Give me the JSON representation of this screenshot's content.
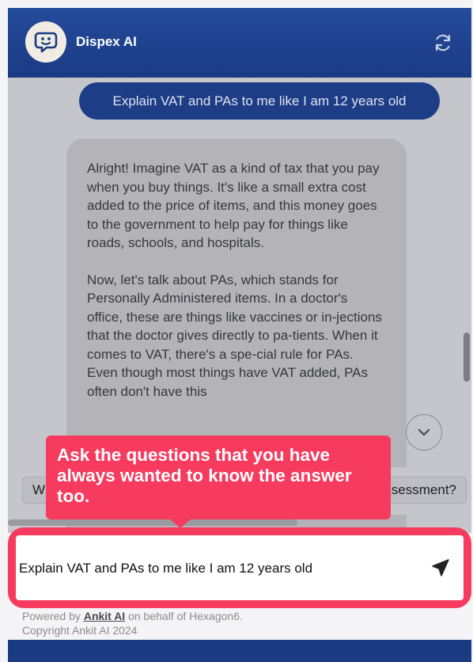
{
  "header": {
    "title": "Dispex AI",
    "avatar_icon": "chat-bubble-icon",
    "refresh_icon": "refresh-icon"
  },
  "chat": {
    "user_message": "Explain VAT and PAs to me like I am 12 years old",
    "bot_paragraph_1": "Alright! Imagine VAT as a kind of tax that you pay when you buy things. It's like a small extra cost added to the price of items, and this money goes to the government to help pay for things like roads, schools, and hospitals.",
    "bot_paragraph_2": "Now, let's talk about PAs, which stands for Personally Administered items. In a doctor's office, these are things like vaccines or in-jections that the doctor gives directly to pa-tients. When it comes to VAT, there's a spe-cial rule for PAs. Even though most things have VAT added, PAs often don't have this"
  },
  "suggestions": {
    "left_label": "W",
    "right_label": "sessment?"
  },
  "tooltip": {
    "text": "Ask the questions that you have always wanted to know the answer too."
  },
  "input": {
    "value": "Explain VAT and PAs to me like I am 12 years old",
    "send_icon": "send-icon"
  },
  "footer": {
    "powered_prefix": "Powered by ",
    "powered_link": "Ankit AI",
    "powered_suffix": " on behalf of Hexagon6.",
    "copyright": "Copyright Ankit AI 2024"
  },
  "colors": {
    "header": "#1b3a84",
    "user_bubble": "#1d3d86",
    "highlight": "#f63b5e"
  }
}
